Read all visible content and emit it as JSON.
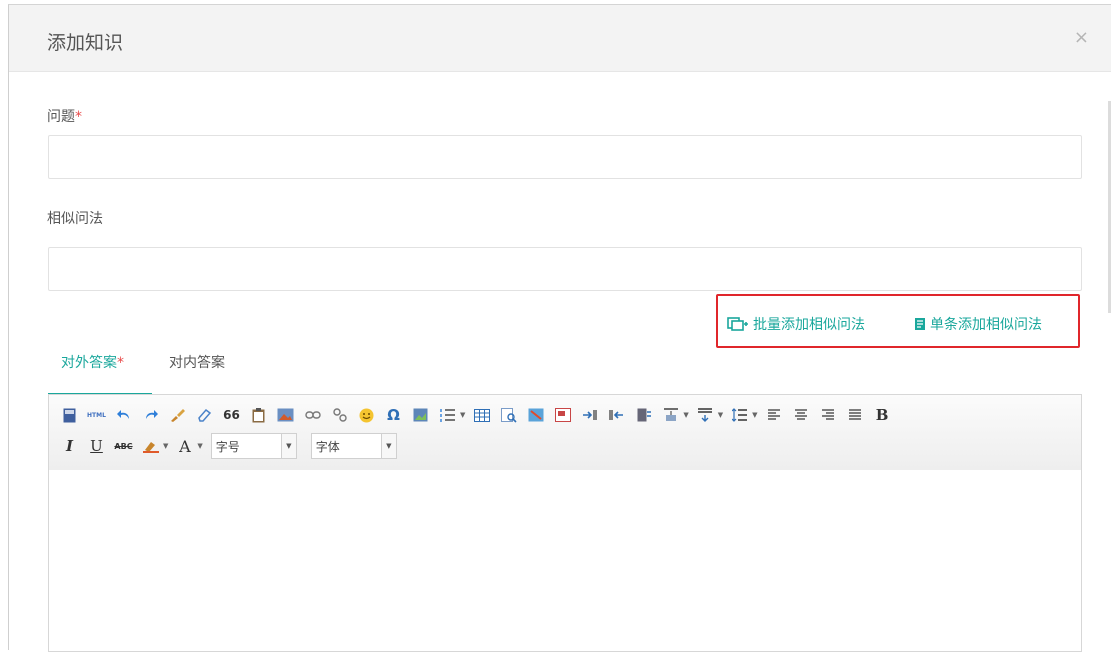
{
  "dialog": {
    "title": "添加知识",
    "close_symbol": "×"
  },
  "question": {
    "label": "问题",
    "required_mark": "*",
    "value": "",
    "placeholder": ""
  },
  "similar": {
    "label": "相似问法",
    "value": "",
    "placeholder": ""
  },
  "actions": {
    "batch_add": "批量添加相似问法",
    "single_add": "单条添加相似问法"
  },
  "tabs": [
    {
      "label": "对外答案",
      "required_mark": "*",
      "active": true
    },
    {
      "label": "对内答案",
      "active": false
    }
  ],
  "toolbar": {
    "font_size": "字号",
    "font_family": "字体",
    "bold": "B",
    "italic": "I",
    "underline": "U",
    "strikethrough": "ABC",
    "font_color": "A",
    "blockquote": "66",
    "special_char": "Ω",
    "html_source": "HTML"
  },
  "colors": {
    "accent": "#1aa79c",
    "required": "#e84a4a",
    "highlight_border": "#e0262b"
  }
}
